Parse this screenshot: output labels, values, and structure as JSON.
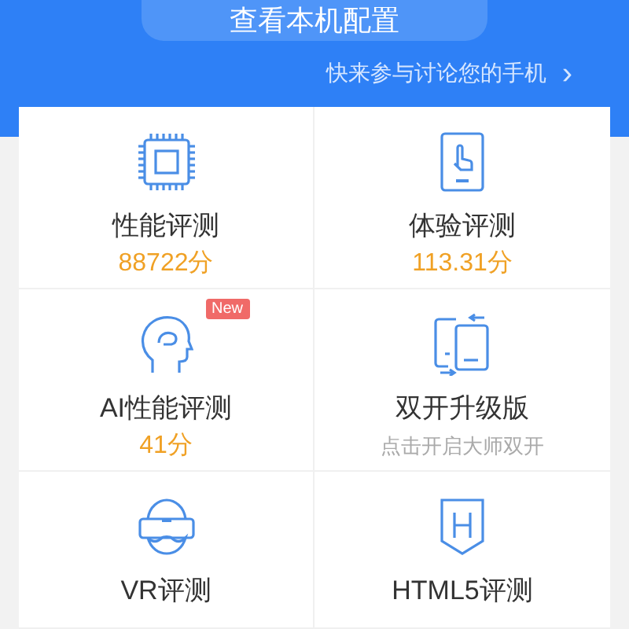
{
  "header": {
    "config_button": "查看本机配置",
    "discuss_link": "快来参与讨论您的手机",
    "discuss_chevron": "›"
  },
  "cells": [
    {
      "kind": "score",
      "title": "性能评测",
      "score": "88722分"
    },
    {
      "kind": "score",
      "title": "体验评测",
      "score": "113.31分"
    },
    {
      "kind": "score",
      "title": "AI性能评测",
      "score": "41分",
      "badge": "New"
    },
    {
      "kind": "feature",
      "title": "双开升级版",
      "subtitle": "点击开启大师双开"
    },
    {
      "kind": "plain",
      "title": "VR评测"
    },
    {
      "kind": "plain",
      "title": "HTML5评测"
    }
  ]
}
